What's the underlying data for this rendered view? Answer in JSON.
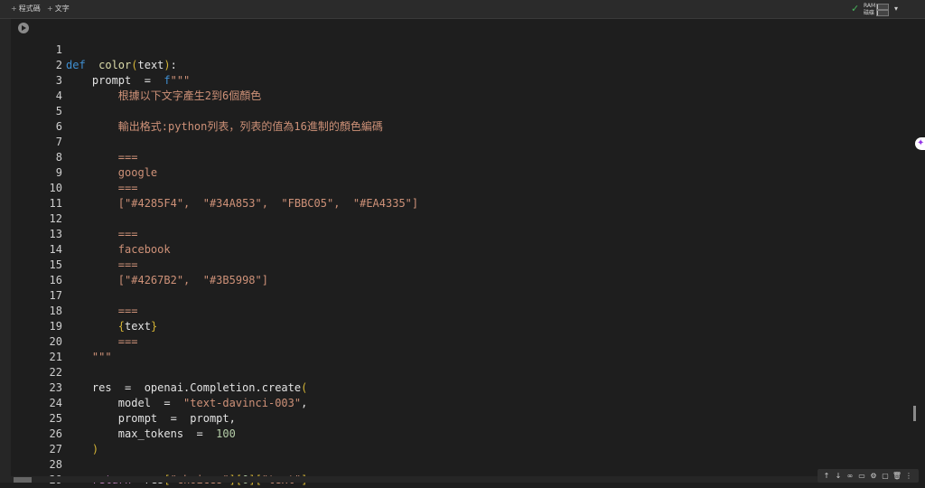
{
  "toolbar": {
    "add_code_label": "程式碼",
    "add_text_label": "文字",
    "ram_label": "RAM",
    "disk_label": "磁碟",
    "ram_usage": 0.1,
    "disk_usage": 0.1
  },
  "icons": {
    "plus": "+",
    "run": "run-cell-icon",
    "check": "✓",
    "caret": "▾",
    "gemini": "✦",
    "cell_toolbar": [
      "↑",
      "↓",
      "∞",
      "▭",
      "⚙",
      "▢",
      "🗑",
      "⋮"
    ]
  },
  "colors": {
    "background": "#1e1e1e",
    "keyword": "#3f8fd2",
    "control": "#c586c0",
    "function": "#dcdcaa",
    "string": "#ce9178",
    "number": "#b5cea8",
    "bracket": "#d4b435",
    "text": "#e2e2e2"
  },
  "code": {
    "lines": [
      [
        {
          "t": "",
          "c": "tx"
        }
      ],
      [
        {
          "t": "def",
          "c": "kw"
        },
        {
          "t": "  color",
          "c": "fn"
        },
        {
          "t": "(",
          "c": "par"
        },
        {
          "t": "text",
          "c": "tx"
        },
        {
          "t": ")",
          "c": "par"
        },
        {
          "t": ":",
          "c": "tx"
        }
      ],
      [
        {
          "t": "    prompt  =  ",
          "c": "tx"
        },
        {
          "t": "f",
          "c": "kw"
        },
        {
          "t": "\"\"\"",
          "c": "str"
        }
      ],
      [
        {
          "t": "        根據以下文字產生2到6個顏色",
          "c": "str"
        }
      ],
      [
        {
          "t": "",
          "c": "tx"
        }
      ],
      [
        {
          "t": "        輸出格式:python列表，列表的值為16進制的顏色編碼",
          "c": "str"
        }
      ],
      [
        {
          "t": "",
          "c": "tx"
        }
      ],
      [
        {
          "t": "        ===",
          "c": "str"
        }
      ],
      [
        {
          "t": "        google",
          "c": "str"
        }
      ],
      [
        {
          "t": "        ===",
          "c": "str"
        }
      ],
      [
        {
          "t": "        [\"#4285F4\",  \"#34A853\",  \"FBBC05\",  \"#EA4335\"]",
          "c": "str"
        }
      ],
      [
        {
          "t": "",
          "c": "tx"
        }
      ],
      [
        {
          "t": "        ===",
          "c": "str"
        }
      ],
      [
        {
          "t": "        facebook",
          "c": "str"
        }
      ],
      [
        {
          "t": "        ===",
          "c": "str"
        }
      ],
      [
        {
          "t": "        [\"#4267B2\",  \"#3B5998\"]",
          "c": "str"
        }
      ],
      [
        {
          "t": "",
          "c": "tx"
        }
      ],
      [
        {
          "t": "        ===",
          "c": "str"
        }
      ],
      [
        {
          "t": "        ",
          "c": "str"
        },
        {
          "t": "{",
          "c": "par"
        },
        {
          "t": "text",
          "c": "tx"
        },
        {
          "t": "}",
          "c": "par"
        }
      ],
      [
        {
          "t": "        ===",
          "c": "str"
        }
      ],
      [
        {
          "t": "    \"\"\"",
          "c": "str"
        }
      ],
      [
        {
          "t": "",
          "c": "tx"
        }
      ],
      [
        {
          "t": "    res  =  openai.Completion.create",
          "c": "tx"
        },
        {
          "t": "(",
          "c": "par"
        }
      ],
      [
        {
          "t": "        model  =  ",
          "c": "tx"
        },
        {
          "t": "\"text-davinci-003\"",
          "c": "str"
        },
        {
          "t": ",",
          "c": "tx"
        }
      ],
      [
        {
          "t": "        prompt  =  prompt,",
          "c": "tx"
        }
      ],
      [
        {
          "t": "        max_tokens  =  ",
          "c": "tx"
        },
        {
          "t": "100",
          "c": "num"
        }
      ],
      [
        {
          "t": "    ",
          "c": "tx"
        },
        {
          "t": ")",
          "c": "par"
        }
      ],
      [
        {
          "t": "",
          "c": "tx"
        }
      ],
      [
        {
          "t": "    ",
          "c": "tx"
        },
        {
          "t": "return",
          "c": "ctl"
        },
        {
          "t": "  res",
          "c": "tx"
        },
        {
          "t": "[",
          "c": "par"
        },
        {
          "t": "\"choices\"",
          "c": "str"
        },
        {
          "t": "]",
          "c": "par"
        },
        {
          "t": "[",
          "c": "par"
        },
        {
          "t": "0",
          "c": "num"
        },
        {
          "t": "]",
          "c": "par"
        },
        {
          "t": "[",
          "c": "par"
        },
        {
          "t": "\"text\"",
          "c": "str"
        },
        {
          "t": "]",
          "c": "par"
        }
      ]
    ]
  }
}
